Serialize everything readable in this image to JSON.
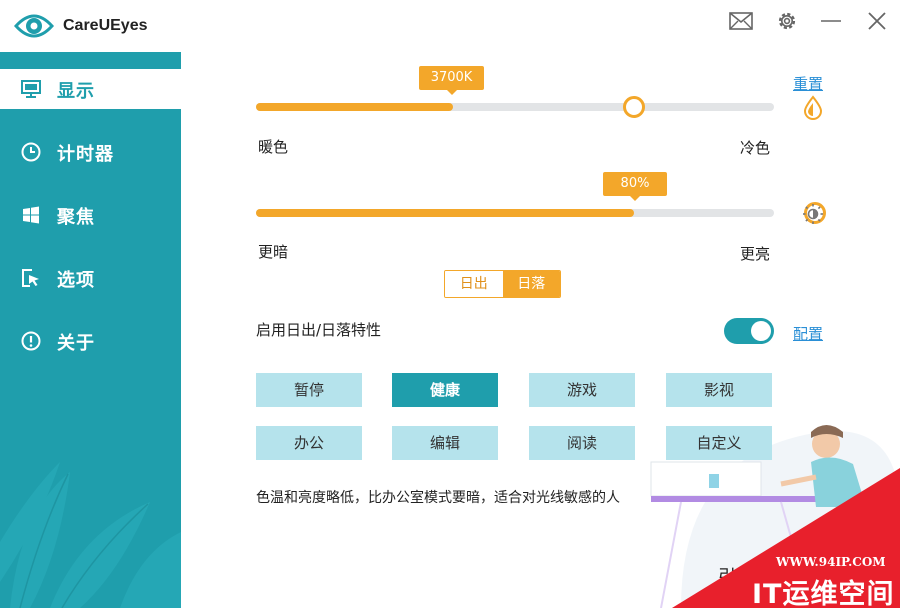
{
  "app": {
    "title": "CareUEyes"
  },
  "titlebar": {
    "icons": [
      "mail-icon",
      "gear-icon",
      "minimize-icon",
      "close-icon"
    ]
  },
  "sidebar": {
    "items": [
      {
        "label": "显示",
        "icon": "monitor-icon",
        "active": true
      },
      {
        "label": "计时器",
        "icon": "clock-icon",
        "active": false
      },
      {
        "label": "聚焦",
        "icon": "windows-icon",
        "active": false
      },
      {
        "label": "选项",
        "icon": "cursor-icon",
        "active": false
      },
      {
        "label": "关于",
        "icon": "info-icon",
        "active": false
      }
    ]
  },
  "display": {
    "temperature": {
      "value_label": "3700K",
      "value": 3700,
      "left_label": "暖色",
      "right_label": "冷色",
      "fill_percent": 38
    },
    "reset_link": "重置",
    "brightness": {
      "value_label": "80%",
      "value": 80,
      "left_label": "更暗",
      "right_label": "更亮",
      "fill_percent": 73
    },
    "segment": {
      "options": [
        "日出",
        "日落"
      ],
      "selected": "日落"
    },
    "sunrise_sunset": {
      "label": "启用日出/日落特性",
      "enabled": true,
      "config_link": "配置"
    },
    "modes": {
      "row1": [
        "暂停",
        "健康",
        "游戏",
        "影视"
      ],
      "row2": [
        "办公",
        "编辑",
        "阅读",
        "自定义"
      ],
      "selected": "健康"
    },
    "description": "色温和亮度略低，比办公室模式要暗，适合对光线敏感的人",
    "partial_text": "引"
  },
  "watermark": {
    "url": "WWW.94IP.COM",
    "text": "IT运维空间"
  },
  "colors": {
    "accent_teal": "#1f9eac",
    "accent_orange": "#f3a72a",
    "light_teal": "#b5e3ec",
    "link_blue": "#2a8fd6",
    "watermark_red": "#e8202c"
  }
}
